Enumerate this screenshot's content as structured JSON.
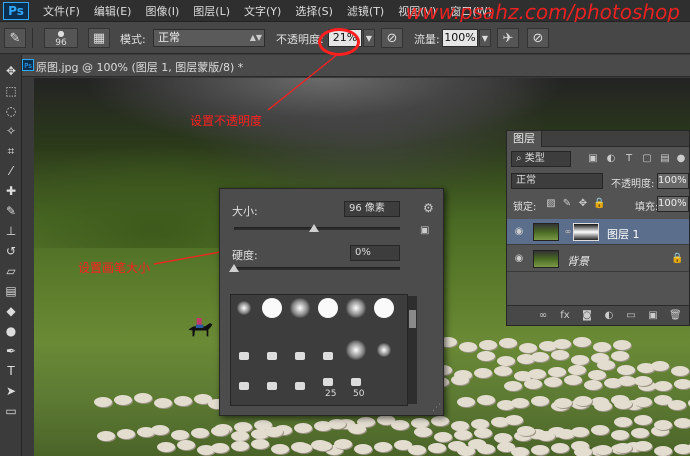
{
  "menu": {
    "logo": "Ps",
    "items": [
      "文件(F)",
      "编辑(E)",
      "图像(I)",
      "图层(L)",
      "文字(Y)",
      "选择(S)",
      "滤镜(T)",
      "视图(V)",
      "窗口(W)"
    ],
    "watermark": "www.psahz.com/photoshop"
  },
  "options": {
    "brush_size": "96",
    "mode_label": "模式:",
    "mode_value": "正常",
    "opacity_label": "不透明度:",
    "opacity_value": "21%",
    "flow_label": "流量:",
    "flow_value": "100%"
  },
  "document": {
    "tab_icon": "Ps",
    "tab_title": "原图.jpg @ 100% (图层 1, 图层蒙版/8) *"
  },
  "annotations": {
    "opacity_note": "设置不透明度",
    "size_note": "设置画笔大小"
  },
  "brush_panel": {
    "size_label": "大小:",
    "size_value": "96 像素",
    "hardness_label": "硬度:",
    "hardness_value": "0%",
    "size_fraction": 0.48,
    "hardness_fraction": 0.0,
    "preset_numbers": [
      "25",
      "50"
    ]
  },
  "layers_panel": {
    "tab": "图层",
    "filter_label": "类型",
    "blend_mode": "正常",
    "opacity_label": "不透明度:",
    "opacity_value": "100%",
    "lock_label": "锁定:",
    "fill_label": "填充:",
    "fill_value": "100%",
    "layers": [
      {
        "name": "图层 1",
        "selected": true
      },
      {
        "name": "背景",
        "selected": false,
        "italic": true
      }
    ]
  },
  "colors": {
    "accent": "#ff1f1f",
    "ps_blue": "#31a8ff",
    "selected_layer": "#5b6f8c"
  }
}
